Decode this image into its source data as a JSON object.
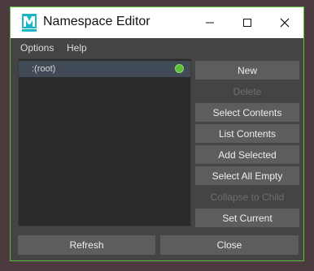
{
  "window": {
    "title": "Namespace Editor",
    "accent_color": "#5cbf3a",
    "app_logo_letter": "M",
    "app_logo_color": "#19b6c4"
  },
  "menubar": {
    "items": [
      {
        "label": "Options"
      },
      {
        "label": "Help"
      }
    ]
  },
  "namespace_list": {
    "items": [
      {
        "label": ":(root)",
        "is_current": true,
        "selected": true
      }
    ]
  },
  "actions": {
    "new": {
      "label": "New",
      "enabled": true
    },
    "delete": {
      "label": "Delete",
      "enabled": false
    },
    "select_contents": {
      "label": "Select Contents",
      "enabled": true
    },
    "list_contents": {
      "label": "List Contents",
      "enabled": true
    },
    "add_selected": {
      "label": "Add Selected",
      "enabled": true
    },
    "select_all_empty": {
      "label": "Select All Empty",
      "enabled": true
    },
    "collapse_to_child": {
      "label": "Collapse to Child",
      "enabled": false
    },
    "set_current": {
      "label": "Set Current",
      "enabled": true
    }
  },
  "footer": {
    "refresh_label": "Refresh",
    "close_label": "Close"
  },
  "icons": {
    "minimize": "minimize-icon",
    "maximize": "maximize-icon",
    "close": "close-icon"
  }
}
